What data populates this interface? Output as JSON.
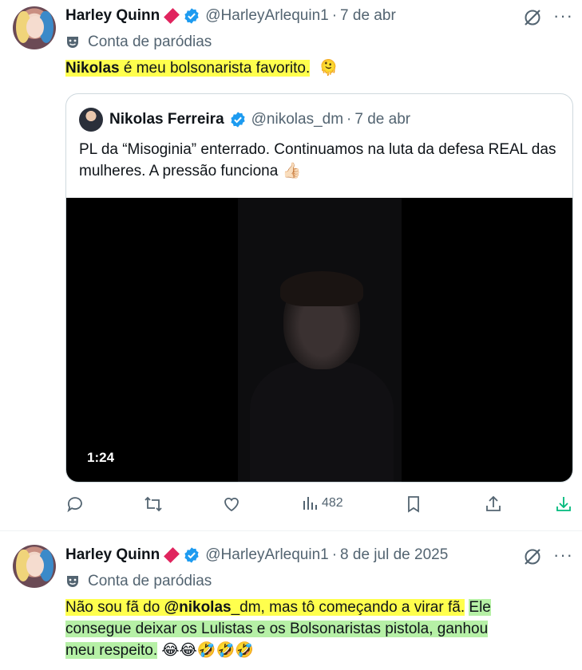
{
  "tweets": [
    {
      "author_name": "Harley Quinn",
      "handle": "@HarleyArlequin1",
      "dot": "·",
      "date": "7 de abr",
      "parody_label": "Conta de paródias",
      "text_highlight": "Nikolas",
      "text_rest": " é meu bolsonarista favorito.",
      "text_emoji": "🫠",
      "quoted": {
        "author_name": "Nikolas Ferreira",
        "handle": "@nikolas_dm",
        "dot": "·",
        "date": "7 de abr",
        "text": "PL da “Misoginia” enterrado. Continuamos na luta da defesa REAL das mulheres. A pressão funciona 👍🏻",
        "video_duration": "1:24"
      },
      "views": "482",
      "more": "···"
    },
    {
      "author_name": "Harley Quinn",
      "handle": "@HarleyArlequin1",
      "dot": "·",
      "date": "8 de jul de 2025",
      "parody_label": "Conta de paródias",
      "text_y1": "Não sou fã do ",
      "text_mention": "@nikolas",
      "text_y2": "_dm, mas tô começando a virar fã.",
      "text_g1": "Ele",
      "text_g2": "consegue deixar os Lulistas e os Bolsonaristas pistola, ganhou",
      "text_g3": "meu respeito.",
      "text_emojis": "😂😂🤣🤣🤣",
      "more": "···"
    }
  ],
  "colors": {
    "verified": "#1d9bf0",
    "secondary_text": "#536471",
    "highlight_yellow": "#ffff4d",
    "highlight_green": "#b6f0a6",
    "diamond": "#e0245e"
  }
}
